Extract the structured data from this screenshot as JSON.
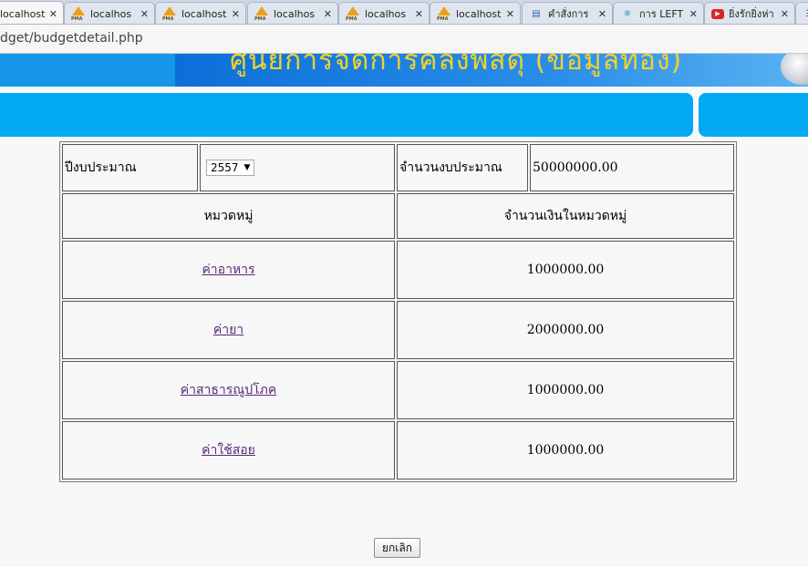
{
  "browser": {
    "tabs": [
      {
        "label": "localhost",
        "icon": "document-icon",
        "active": true
      },
      {
        "label": "localhos",
        "icon": "phpmyadmin-icon"
      },
      {
        "label": "localhost",
        "icon": "phpmyadmin-icon"
      },
      {
        "label": "localhos",
        "icon": "phpmyadmin-icon"
      },
      {
        "label": "localhos",
        "icon": "phpmyadmin-icon"
      },
      {
        "label": "localhost",
        "icon": "phpmyadmin-icon"
      },
      {
        "label": "คำสั่งการ",
        "icon": "page-icon"
      },
      {
        "label": "การ LEFT",
        "icon": "snowflake-icon"
      },
      {
        "label": "ยิ่งรักยิ่งห่า",
        "icon": "youtube-icon"
      }
    ],
    "close_glyph": "✕",
    "url": "dget/budgetdetail.php"
  },
  "banner": {
    "title": "ศูนย์การจัดการคลังพัสดุ (ข้อมูลทอง)"
  },
  "form": {
    "year_label": "ปีงบประมาณ",
    "year_value": "2557",
    "budget_label": "จำนวนงบประมาณ",
    "budget_value": "50000000.00",
    "col_category": "หมวดหมู่",
    "col_amount": "จำนวนเงินในหมวดหมู่",
    "rows": [
      {
        "category": "ค่าอาหาร",
        "amount": "1000000.00"
      },
      {
        "category": "ค่ายา",
        "amount": "2000000.00"
      },
      {
        "category": "ค่าสาธารณูปโภค",
        "amount": "1000000.00"
      },
      {
        "category": "ค่าใช้สอย",
        "amount": "1000000.00"
      }
    ],
    "cancel_label": "ยกเลิก"
  }
}
